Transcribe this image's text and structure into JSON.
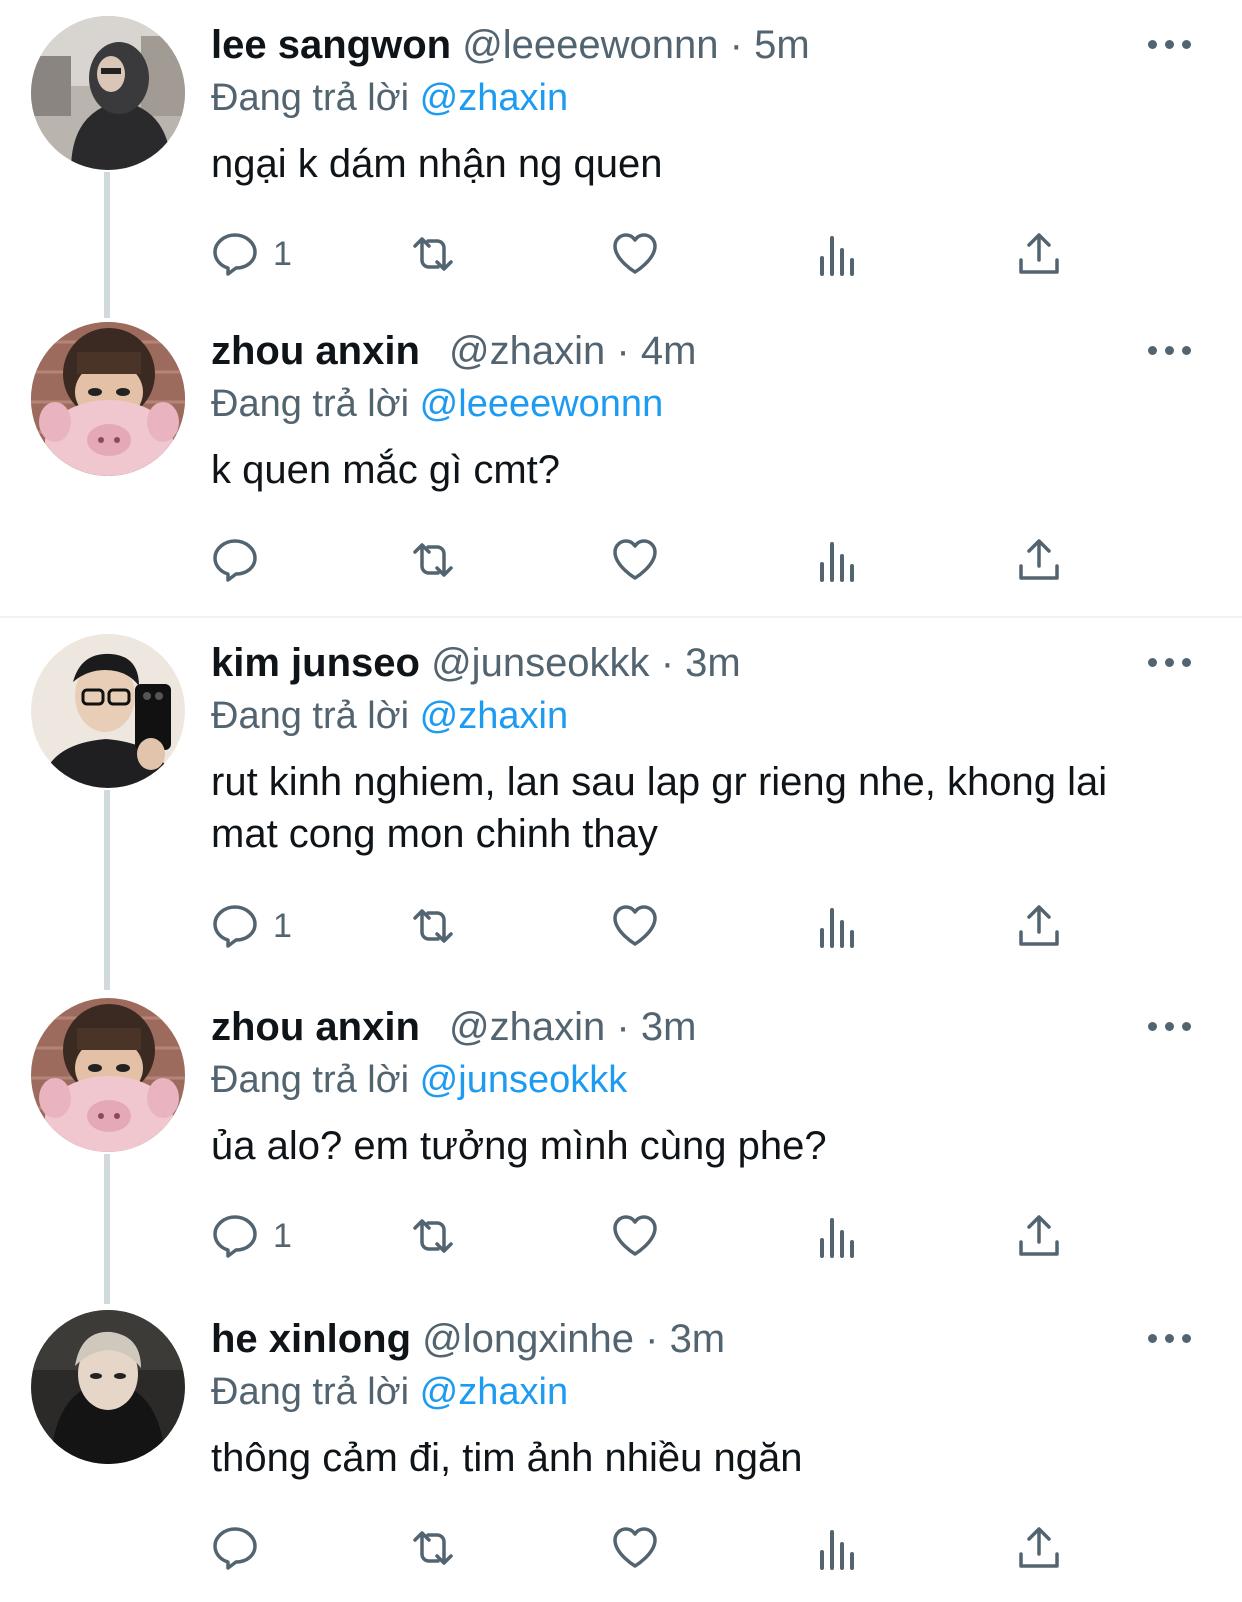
{
  "reply_prefix": "Đang trả lời",
  "colors": {
    "text": "#0f1419",
    "secondary": "#536471",
    "mention": "#1d9bf0",
    "thread_line": "#cfd9de",
    "separator": "#eff3f4"
  },
  "tweets": [
    {
      "name": "lee sangwon",
      "handle": "@leeeewonnn",
      "dot": "·",
      "time": "5m",
      "replying_to": "@zhaxin",
      "text": "ngại k dám nhận ng quen",
      "reply_count": "1",
      "avatar": "avatar-hooded-person"
    },
    {
      "name": "zhou anxin",
      "handle": "@zhaxin",
      "dot": "·",
      "time": "4m",
      "replying_to": "@leeeewonnn",
      "text": "k quen mắc gì cmt?",
      "reply_count": "",
      "avatar": "avatar-pink-plush"
    },
    {
      "name": "kim junseo",
      "handle": "@junseokkk",
      "dot": "·",
      "time": "3m",
      "replying_to": "@zhaxin",
      "text": "rut kinh nghiem, lan sau lap gr rieng nhe, khong lai mat cong mon chinh thay",
      "reply_count": "1",
      "avatar": "avatar-glasses-selfie"
    },
    {
      "name": "zhou anxin",
      "handle": "@zhaxin",
      "dot": "·",
      "time": "3m",
      "replying_to": "@junseokkk",
      "text": "ủa alo? em tưởng mình cùng phe?",
      "reply_count": "1",
      "avatar": "avatar-pink-plush"
    },
    {
      "name": "he xinlong",
      "handle": "@longxinhe",
      "dot": "·",
      "time": "3m",
      "replying_to": "@zhaxin",
      "text": "thông cảm đi, tim ảnh nhiều ngăn",
      "reply_count": "",
      "avatar": "avatar-dark-hoodie"
    }
  ]
}
